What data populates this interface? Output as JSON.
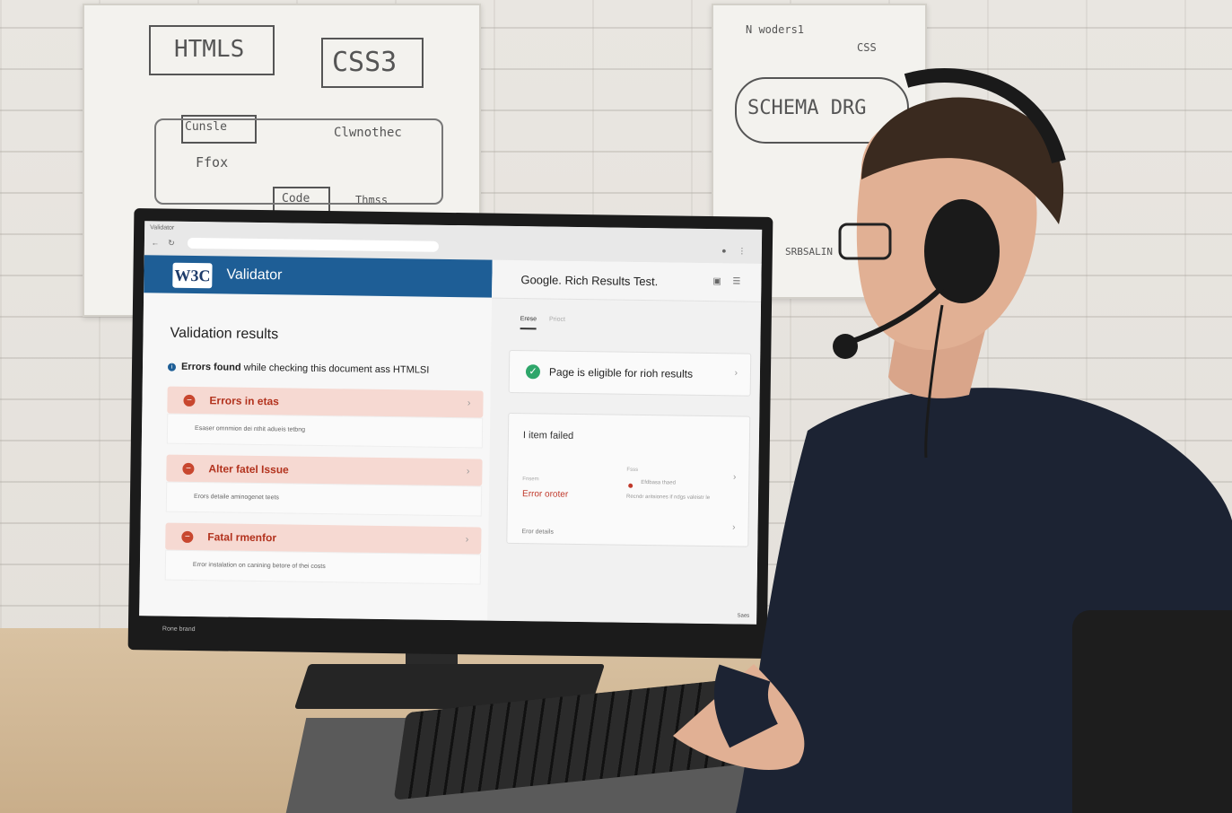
{
  "whiteboard_left": {
    "box1": "HTMLS",
    "box2": "CSS3",
    "box3": "Cunsle",
    "label1": "Clwnothec",
    "label2": "Ffox",
    "box4": "Code",
    "label3": "Thmss"
  },
  "whiteboard_right": {
    "top_note": "N woders1",
    "top_note_b": "CSS",
    "schema": "SCHEMA DRG",
    "bottom_note": "SRBSALIN"
  },
  "browser": {
    "tab_title": "Validator"
  },
  "w3c": {
    "logo": "W3C",
    "title": "Validator",
    "results_heading": "Validation results",
    "notice_bold": "Errors found",
    "notice_rest": "while checking this document ass HTMLSI",
    "errors": [
      {
        "title": "Errors in etas",
        "detail": "Esaser omnmion dei nthit adueis tetbng"
      },
      {
        "title": "Alter fatel Issue",
        "detail": "Erors detaile aminogenet teets"
      },
      {
        "title": "Fatal rmenfor",
        "detail": "Error instalation on canining betore of thei costs"
      }
    ]
  },
  "google": {
    "title": "Google. Rich Results Test.",
    "tabs": [
      "Erese",
      "Prioct"
    ],
    "eligible_text": "Page is eligible for rioh results",
    "failed_title": "I item failed",
    "col_left_label": "Fnsem",
    "col_right_label": "Fsss",
    "error_value": "Error oroter",
    "right_line1": "Efdbasa thaed",
    "right_line2": "Recndr aritsiones if ndgs valeistr le",
    "error_details": "Eror details"
  },
  "screen_status": "Saes",
  "monitor_brand": "Rone brand",
  "colors": {
    "w3c_blue": "#1e5e96",
    "error_red": "#c8472f",
    "error_bg": "#f6d9d2",
    "ok_green": "#2ea66a"
  }
}
